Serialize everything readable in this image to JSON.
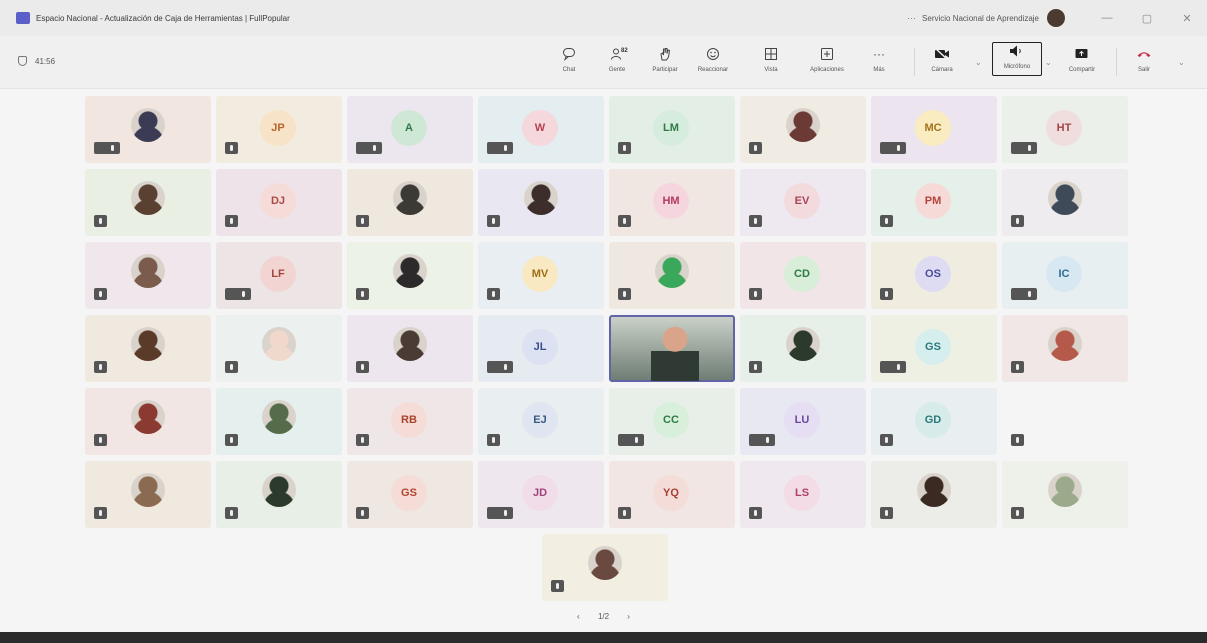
{
  "window": {
    "title": "Espacio Nacional - Actualización de Caja de Herramientas | FullPopular",
    "more": "···",
    "org": "Servicio Nacional de Aprendizaje",
    "buttons": {
      "minimize": "—",
      "maximize": "▢",
      "close": "✕"
    }
  },
  "toolbar": {
    "timer": "41:56",
    "buttons": [
      {
        "name": "chat",
        "label": "Chat",
        "icon": "chat-icon"
      },
      {
        "name": "people",
        "label": "Gente",
        "icon": "people-icon",
        "badge": "82"
      },
      {
        "name": "raise-hand",
        "label": "Participar",
        "icon": "hand-icon"
      },
      {
        "name": "react",
        "label": "Reaccionar",
        "icon": "smile-icon"
      },
      {
        "name": "view",
        "label": "Vista",
        "icon": "grid-icon"
      },
      {
        "name": "apps",
        "label": "Aplicaciones",
        "icon": "plus-icon"
      },
      {
        "name": "more",
        "label": "Más",
        "icon": "more-icon"
      },
      {
        "name": "camera",
        "label": "Cámara",
        "icon": "camera-off-icon"
      },
      {
        "name": "mic",
        "label": "Micrófono",
        "icon": "speaker-icon"
      },
      {
        "name": "share",
        "label": "Compartir",
        "icon": "share-icon"
      },
      {
        "name": "leave",
        "label": "Salir",
        "icon": "phone-icon"
      }
    ]
  },
  "participants": [
    {
      "type": "photo",
      "bg": "#f1e7e0",
      "face": "#3b3b55",
      "mic": "double"
    },
    {
      "type": "initials",
      "initials": "JP",
      "bg": "#f2ece0",
      "circle": "#f7e3c8",
      "color": "#b9642c",
      "mic": "single"
    },
    {
      "type": "initials",
      "initials": "A",
      "bg": "#ece7ef",
      "circle": "#cfe8d6",
      "color": "#2f7a4a",
      "mic": "double"
    },
    {
      "type": "initials",
      "initials": "W",
      "bg": "#e4eef1",
      "circle": "#f4d8dc",
      "color": "#b34254",
      "mic": "double"
    },
    {
      "type": "initials",
      "initials": "LM",
      "bg": "#e3efe6",
      "circle": "#d6ecdc",
      "color": "#2f7a4a",
      "mic": "single"
    },
    {
      "type": "photo",
      "bg": "#f1ece3",
      "face": "#6b3a34",
      "mic": "single"
    },
    {
      "type": "initials",
      "initials": "MC",
      "bg": "#ece5ef",
      "circle": "#f9ecc0",
      "color": "#a4731c",
      "mic": "double"
    },
    {
      "type": "initials",
      "initials": "HT",
      "bg": "#ecf0ea",
      "circle": "#f0dede",
      "color": "#a14545",
      "mic": "double"
    },
    {
      "type": "photo",
      "bg": "#e9efe3",
      "face": "#5a4030",
      "mic": "single"
    },
    {
      "type": "initials",
      "initials": "DJ",
      "bg": "#efe3ea",
      "circle": "#f5dcd9",
      "color": "#a94a46",
      "mic": "single"
    },
    {
      "type": "photo",
      "bg": "#efe8df",
      "face": "#3c3a34",
      "mic": "single"
    },
    {
      "type": "photo",
      "bg": "#e8e7f2",
      "face": "#3d2e2b",
      "mic": "single"
    },
    {
      "type": "initials",
      "initials": "HM",
      "bg": "#f1e7e2",
      "circle": "#f6d6de",
      "color": "#b23a5a",
      "mic": "single"
    },
    {
      "type": "initials",
      "initials": "EV",
      "bg": "#eee8f1",
      "circle": "#f3dadd",
      "color": "#a64556",
      "mic": "single"
    },
    {
      "type": "initials",
      "initials": "PM",
      "bg": "#e6f0ea",
      "circle": "#f6dad8",
      "color": "#b3443c",
      "mic": "single"
    },
    {
      "type": "photo",
      "bg": "#efecef",
      "face": "#3e4a58",
      "mic": "single"
    },
    {
      "type": "photo",
      "bg": "#efe7ec",
      "face": "#7a5b4c",
      "mic": "single"
    },
    {
      "type": "initials",
      "initials": "LF",
      "bg": "#ede4e5",
      "circle": "#f2d5d2",
      "color": "#a4443c",
      "mic": "double"
    },
    {
      "type": "photo",
      "bg": "#ecf2e6",
      "face": "#2c2a2a",
      "mic": "single"
    },
    {
      "type": "initials",
      "initials": "MV",
      "bg": "#e9eef3",
      "circle": "#f8e9c2",
      "color": "#9e6f16",
      "mic": "single"
    },
    {
      "type": "photo",
      "bg": "#eee8e0",
      "face": "#39a85a",
      "mic": "single"
    },
    {
      "type": "initials",
      "initials": "CD",
      "bg": "#f1e5e8",
      "circle": "#d8eed9",
      "color": "#2f7a44",
      "mic": "single"
    },
    {
      "type": "initials",
      "initials": "OS",
      "bg": "#f0ede0",
      "circle": "#dedcf2",
      "color": "#4a4a9a",
      "mic": "single"
    },
    {
      "type": "initials",
      "initials": "IC",
      "bg": "#e8eff1",
      "circle": "#d7e8f2",
      "color": "#2f6a8c",
      "mic": "double"
    },
    {
      "type": "photo",
      "bg": "#f0e9df",
      "face": "#5a3a28",
      "mic": "single"
    },
    {
      "type": "photo",
      "bg": "#ecf0ee",
      "face": "#f0d8cc",
      "mic": "single"
    },
    {
      "type": "photo",
      "bg": "#ede6ef",
      "face": "#4a3b34",
      "mic": "single"
    },
    {
      "type": "initials",
      "initials": "JL",
      "bg": "#e6eaf1",
      "circle": "#dde2f3",
      "color": "#3a4f8c",
      "mic": "double"
    },
    {
      "type": "video",
      "mic": "none"
    },
    {
      "type": "photo",
      "bg": "#e6efe8",
      "face": "#2b3a2a",
      "mic": "single"
    },
    {
      "type": "initials",
      "initials": "GS",
      "bg": "#eef0e4",
      "circle": "#d6eeee",
      "color": "#2c7a7c",
      "mic": "double"
    },
    {
      "type": "photo",
      "bg": "#f1e7e6",
      "face": "#b55a4a",
      "mic": "single"
    },
    {
      "type": "photo",
      "bg": "#f1e6e3",
      "face": "#8a3a30",
      "mic": "single"
    },
    {
      "type": "photo",
      "bg": "#e4efee",
      "face": "#556b4a",
      "mic": "single"
    },
    {
      "type": "initials",
      "initials": "RB",
      "bg": "#efe6e8",
      "circle": "#f6dcd6",
      "color": "#a9442e",
      "mic": "single"
    },
    {
      "type": "initials",
      "initials": "EJ",
      "bg": "#e9eef1",
      "circle": "#dfe6f1",
      "color": "#3c5a86",
      "mic": "single"
    },
    {
      "type": "initials",
      "initials": "CC",
      "bg": "#e7efe8",
      "circle": "#d8efdb",
      "color": "#2f7a44",
      "mic": "double"
    },
    {
      "type": "initials",
      "initials": "LU",
      "bg": "#e8e8f2",
      "circle": "#e6def3",
      "color": "#6a4a9a",
      "mic": "double"
    },
    {
      "type": "initials",
      "initials": "GD",
      "bg": "#e9eef0",
      "circle": "#d7ebeb",
      "color": "#2a7a7a",
      "mic": "single"
    },
    {
      "type": "empty",
      "mic": "single"
    },
    {
      "type": "photo",
      "bg": "#efe9e0",
      "face": "#8a6a50",
      "mic": "single"
    },
    {
      "type": "photo",
      "bg": "#e7efe7",
      "face": "#2c3a2c",
      "mic": "single"
    },
    {
      "type": "initials",
      "initials": "GS",
      "bg": "#efe7e2",
      "circle": "#f5dcd6",
      "color": "#b0442e",
      "mic": "single"
    },
    {
      "type": "initials",
      "initials": "JD",
      "bg": "#eee8ee",
      "circle": "#f1dcea",
      "color": "#a0447a",
      "mic": "double"
    },
    {
      "type": "initials",
      "initials": "YQ",
      "bg": "#f1e6e3",
      "circle": "#f4dcd8",
      "color": "#a84035",
      "mic": "single"
    },
    {
      "type": "initials",
      "initials": "LS",
      "bg": "#efe8ee",
      "circle": "#f4dce6",
      "color": "#ad3f6a",
      "mic": "single"
    },
    {
      "type": "photo",
      "bg": "#ecece8",
      "face": "#3a2a22",
      "mic": "single"
    },
    {
      "type": "photo",
      "bg": "#eef0ea",
      "face": "#9aaa8a",
      "mic": "single"
    },
    {
      "type": "photo",
      "bg": "#f2efe2",
      "face": "#6a4a40",
      "mic": "single"
    }
  ],
  "pager": {
    "prev": "‹",
    "label": "1/2",
    "next": "›"
  }
}
